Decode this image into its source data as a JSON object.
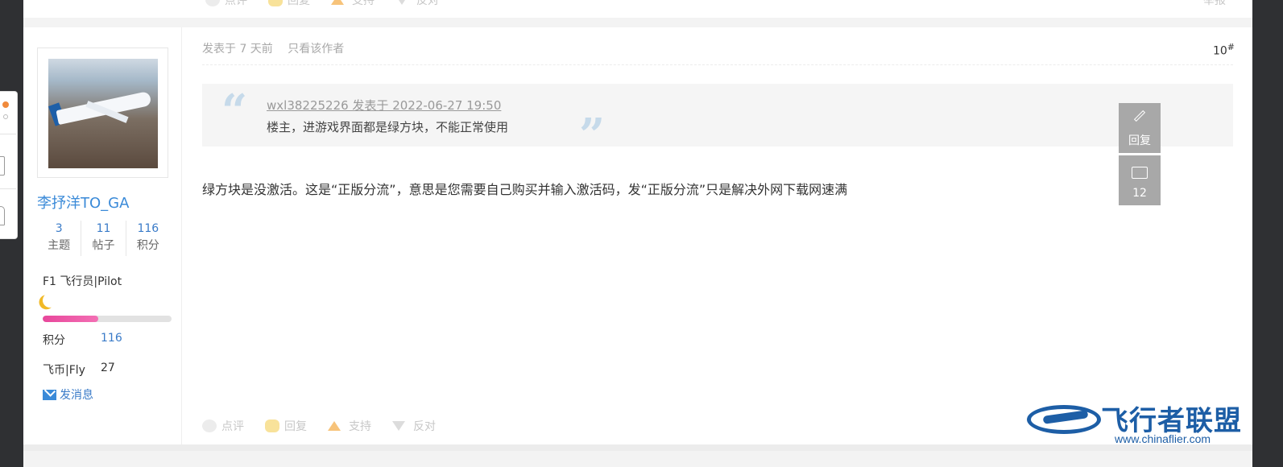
{
  "prev_post": {
    "actions": [
      "点评",
      "回复",
      "支持",
      "反对"
    ],
    "report": "举报"
  },
  "post": {
    "author": {
      "username": "李抒洋TO_GA",
      "stats": [
        {
          "num": "3",
          "label": "主题"
        },
        {
          "num": "11",
          "label": "帖子"
        },
        {
          "num": "116",
          "label": "积分"
        }
      ],
      "rank": "F1 飞行员|Pilot",
      "progress_fraction": 0.43,
      "credits_label": "积分",
      "credits_value": "116",
      "fly_label": "飞币|Fly",
      "fly_value": "27",
      "send_message": "发消息"
    },
    "meta": {
      "posted": "发表于 7 天前",
      "only_author": "只看该作者",
      "floor": "10",
      "floor_mark": "#"
    },
    "quote": {
      "header": "wxl38225226 发表于 2022-06-27 19:50",
      "text": "楼主，进游戏界面都是绿方块，不能正常使用"
    },
    "message": "绿方块是没激活。这是“正版分流”，意思是您需要自己购买并输入激活码，发“正版分流”只是解决外网下载网速满",
    "actions": [
      "点评",
      "回复",
      "支持",
      "反对"
    ]
  },
  "float_tools": {
    "reply_label": "回复",
    "comment_count": "12"
  },
  "logo": {
    "name": "飞行者联盟",
    "url": "www.chinaflier.com"
  },
  "colors": {
    "link_blue": "#3a7bc8",
    "brand_blue": "#1d5ea6",
    "progress_pink": "#e8479b"
  }
}
